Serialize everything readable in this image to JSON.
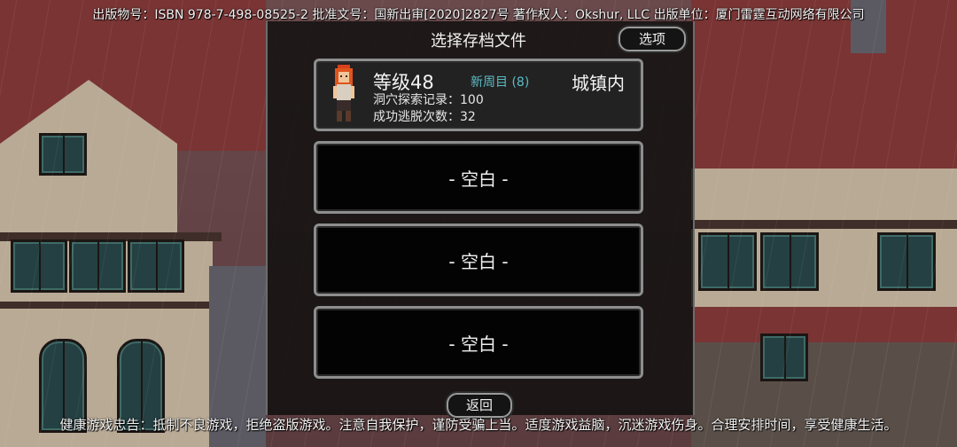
{
  "header": {
    "publish_info": "出版物号：ISBN 978-7-498-08525-2 批准文号：国新出审[2020]2827号 著作权人：Okshur, LLC 出版单位：厦门雷霆互动网络有限公司"
  },
  "panel": {
    "title": "选择存档文件",
    "options_label": "选项",
    "back_label": "返回"
  },
  "save_slots": [
    {
      "level": "等级48",
      "new_game_plus": "新周目 (8)",
      "location": "城镇内",
      "cave_record": "洞穴探索记录：100",
      "escapes": "成功逃脱次数：32"
    },
    {
      "empty_label": "- 空白 -"
    },
    {
      "empty_label": "- 空白 -"
    },
    {
      "empty_label": "- 空白 -"
    }
  ],
  "footer": {
    "health_notice": "健康游戏忠告：抵制不良游戏，拒绝盗版游戏。注意自我保护，谨防受骗上当。适度游戏益脑，沉迷游戏伤身。合理安排时间，享受健康生活。"
  },
  "colors": {
    "panel_bg": "#0e0e0e",
    "slot_border": "#8e8e8e",
    "new_game_plus": "#5bbcc6",
    "roof": "#7a3434"
  }
}
